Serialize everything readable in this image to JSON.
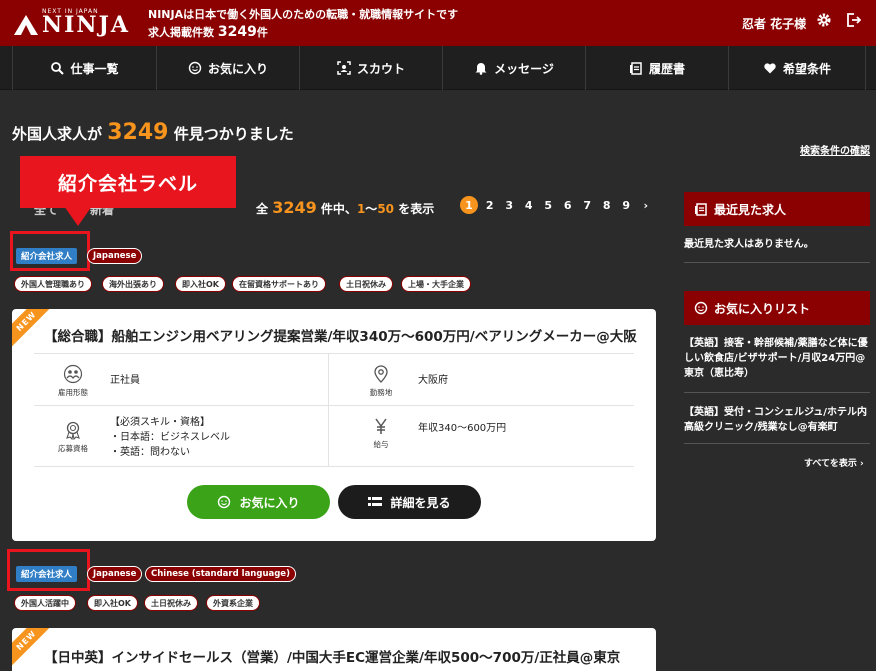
{
  "header": {
    "logo_small": "NEXT IN JAPAN",
    "logo_word": "NINJA",
    "tagline": "NINJAは日本で働く外国人のための転職・就職情報サイトです",
    "job_count_prefix": "求人掲載件数",
    "job_count_value": "3249",
    "job_count_suffix": "件",
    "username": "忍者 花子様"
  },
  "nav": {
    "items": [
      {
        "label": "仕事一覧",
        "icon": "search-icon"
      },
      {
        "label": "お気に入り",
        "icon": "smile-icon"
      },
      {
        "label": "スカウト",
        "icon": "scan-icon"
      },
      {
        "label": "メッセージ",
        "icon": "bell-icon"
      },
      {
        "label": "履歴書",
        "icon": "document-icon"
      },
      {
        "label": "希望条件",
        "icon": "heart-icon"
      }
    ]
  },
  "results": {
    "prefix": "外国人求人が",
    "count": "3249",
    "suffix": "件見つかりました",
    "search_link": "検索条件の確認"
  },
  "annotation": {
    "label": "紹介会社ラベル"
  },
  "sort": {
    "label1": "全て",
    "label2": "新着"
  },
  "count_line": {
    "prefix": "全",
    "total": "3249",
    "middle": "件中、",
    "from": "1",
    "sep": "〜",
    "to": "50",
    "suffix": "を表示"
  },
  "pager": {
    "pages": [
      "1",
      "2",
      "3",
      "4",
      "5",
      "6",
      "7",
      "8",
      "9"
    ],
    "next": "›"
  },
  "job1": {
    "badge": "紹介会社求人",
    "langs": [
      "Japanese"
    ],
    "tags": [
      "外国人管理職あり",
      "海外出張あり",
      "即入社OK",
      "在留資格サポートあり",
      "土日祝休み",
      "上場・大手企業"
    ],
    "ribbon": "NEW",
    "title": "【総合職】船舶エンジン用ベアリング提案営業/年収340万〜600万円/ベアリングメーカー@大阪",
    "employment_label": "雇用形態",
    "employment_value": "正社員",
    "location_label": "勤務地",
    "location_value": "大阪府",
    "qual_label": "応募資格",
    "qual_lines": [
      "【必須スキル・資格】",
      "・日本語：ビジネスレベル",
      "・英語：問わない"
    ],
    "salary_label": "給与",
    "salary_value": "年収340〜600万円",
    "fav_button": "お気に入り",
    "detail_button": "詳細を見る"
  },
  "job2": {
    "badge": "紹介会社求人",
    "langs": [
      "Japanese",
      "Chinese (standard language)"
    ],
    "tags": [
      "外国人活躍中",
      "即入社OK",
      "土日祝休み",
      "外資系企業"
    ],
    "ribbon": "NEW",
    "title": "【日中英】インサイドセールス（営業）/中国大手EC運営企業/年収500〜700万/正社員@東京"
  },
  "sidebar": {
    "recent_title": "最近見た求人",
    "recent_empty": "最近見た求人はありません。",
    "fav_title": "お気に入りリスト",
    "fav_items": [
      "【英語】接客・幹部候補/薬膳など体に優しい飲食店/ビザサポート/月収24万円@東京（恵比寿）",
      "【英語】受付・コンシェルジュ/ホテル内高級クリニック/残業なし@有楽町"
    ],
    "see_all": "すべてを表示 ›"
  },
  "colors": {
    "brand_red": "#8b0000",
    "accent_orange": "#f7941d",
    "annotation_red": "#e8141e",
    "badge_blue": "#2f7ec6",
    "button_green": "#3aa317"
  }
}
